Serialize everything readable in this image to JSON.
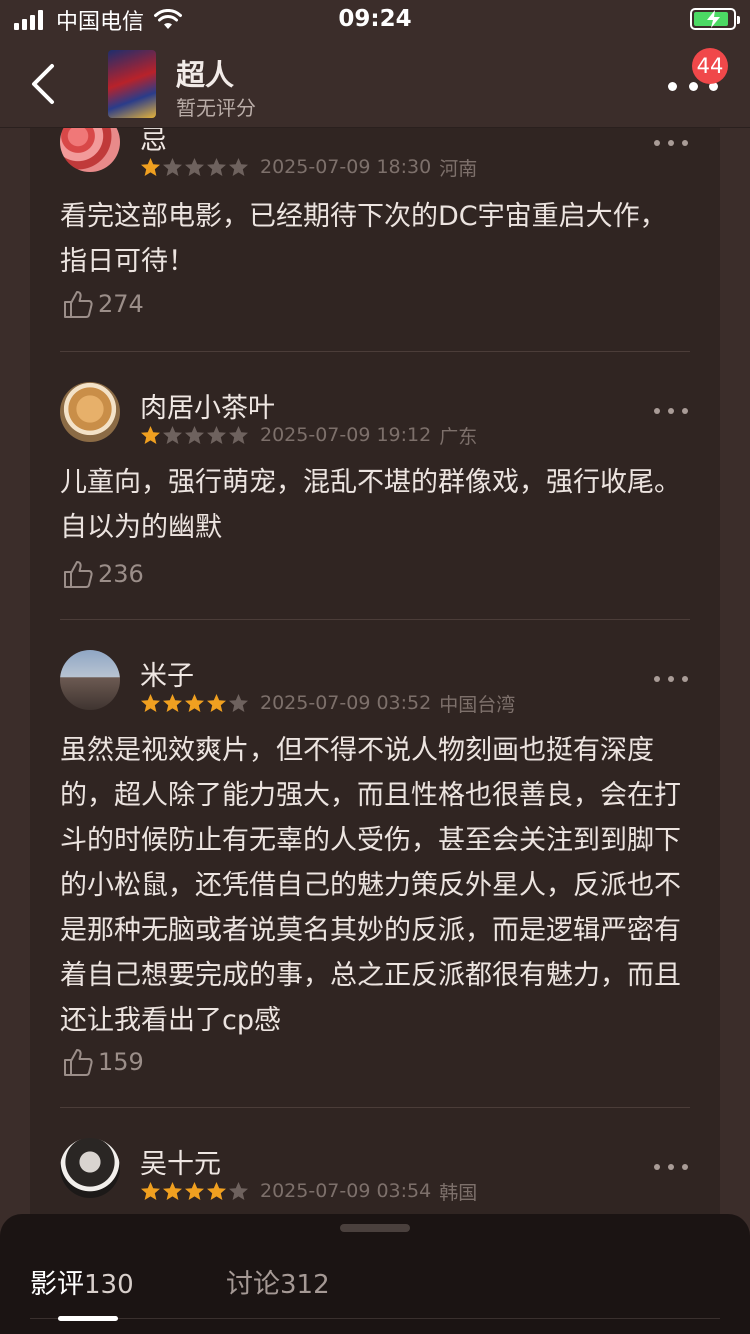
{
  "status_bar": {
    "carrier": "中国电信",
    "time": "09:24"
  },
  "nav": {
    "title": "超人",
    "subtitle": "暂无评分",
    "badge_count": "44",
    "icons": {
      "back": "chevron-left-icon",
      "more": "more-horizontal-icon"
    }
  },
  "colors": {
    "background": "#3b2d2a",
    "card": "#302522",
    "star_on": "#f0a020",
    "star_off": "#6e625e",
    "badge": "#f0484a",
    "sheet": "#1b1413"
  },
  "comments": [
    {
      "username": "忌",
      "stars": 1,
      "time": "2025-07-09 18:30",
      "location": "河南",
      "text": "看完这部电影，已经期待下次的DC宇宙重启大作，指日可待！",
      "likes": "274"
    },
    {
      "username": "肉居小茶叶",
      "stars": 1,
      "time": "2025-07-09 19:12",
      "location": "广东",
      "text": "儿童向，强行萌宠，混乱不堪的群像戏，强行收尾。自以为的幽默",
      "likes": "236"
    },
    {
      "username": "米子",
      "stars": 4,
      "time": "2025-07-09 03:52",
      "location": "中国台湾",
      "text": "虽然是视效爽片，但不得不说人物刻画也挺有深度的，超人除了能力强大，而且性格也很善良，会在打斗的时候防止有无辜的人受伤，甚至会关注到到脚下的小松鼠，还凭借自己的魅力策反外星人，反派也不是那种无脑或者说莫名其妙的反派，而是逻辑严密有着自己想要完成的事，总之正反派都很有魅力，而且还让我看出了cp感",
      "likes": "159"
    },
    {
      "username": "吴十元",
      "stars": 4,
      "time": "2025-07-09 03:54",
      "location": "韩国",
      "text": "",
      "likes": ""
    }
  ],
  "tabs": [
    {
      "label": "影评",
      "count": "130",
      "active": true
    },
    {
      "label": "讨论",
      "count": "312",
      "active": false
    }
  ]
}
